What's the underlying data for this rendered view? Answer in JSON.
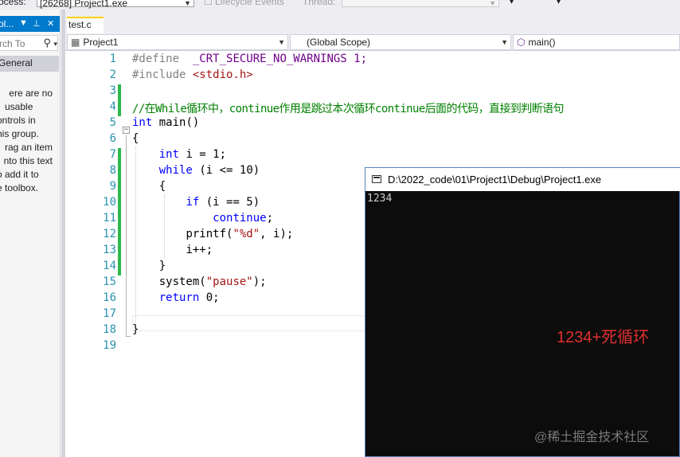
{
  "toolbar": {
    "process_label": "ocess:",
    "process_value": "[26268] Project1.exe",
    "lifecycle_label": "Lifecycle Events",
    "thread_label": "Thread:"
  },
  "toolbox": {
    "title": "ol...",
    "search_placeholder": "rch To",
    "group_label": "General",
    "empty_message_lines": [
      "ere are no",
      "usable",
      "ontrols in",
      "his group.",
      "rag an item",
      "nto this text",
      "o add it to",
      "e toolbox."
    ]
  },
  "editor": {
    "tab_label": "test.c",
    "nav": {
      "project": "Project1",
      "scope": "(Global Scope)",
      "member": "main()"
    },
    "line_numbers": [
      "1",
      "2",
      "3",
      "4",
      "5",
      "6",
      "7",
      "8",
      "9",
      "10",
      "11",
      "12",
      "13",
      "14",
      "15",
      "16",
      "17",
      "18",
      "19"
    ],
    "code": {
      "l1_directive": "#define",
      "l1_rest": "_CRT_SECURE_NO_WARNINGS 1;",
      "l2_directive": "#include",
      "l2_header": "<stdio.h>",
      "l4_comment": "//在While循环中，continue作用是跳过本次循环continue后面的代码，直接到判断语句",
      "l5_type": "int",
      "l5_rest": "main()",
      "l6": "{",
      "l7_type": "int",
      "l7_rest": "i = 1;",
      "l8_kw": "while",
      "l8_rest": "(i <= 10)",
      "l9": "{",
      "l10_kw": "if",
      "l10_rest": "(i == 5)",
      "l11_kw": "continue",
      "l11_rest": ";",
      "l12_fn": "printf(",
      "l12_str": "\"%d\"",
      "l12_rest": ", i);",
      "l13": "i++;",
      "l14": "}",
      "l15_fn": "system(",
      "l15_str": "\"pause\"",
      "l15_rest": ");",
      "l16_kw": "return",
      "l16_rest": "0;",
      "l18": "}"
    }
  },
  "console": {
    "title": "D:\\2022_code\\01\\Project1\\Debug\\Project1.exe",
    "output": "1234",
    "annotation": "1234+死循环",
    "watermark": "@稀土掘金技术社区"
  }
}
